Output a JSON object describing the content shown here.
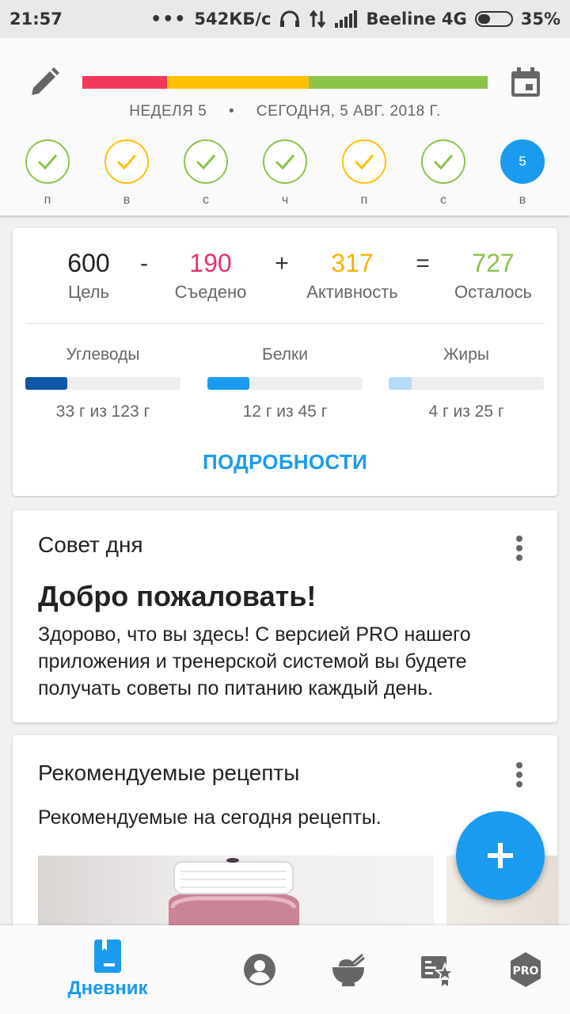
{
  "status_bar": {
    "time": "21:57",
    "dots": "•••",
    "speed": "542КБ/с",
    "carrier": "Beeline 4G",
    "battery": "35%",
    "battery_level": 0.35
  },
  "header": {
    "week": "НЕДЕЛЯ 5",
    "separator": "•",
    "date": "СЕГОДНЯ, 5 АВГ. 2018 Г.",
    "progress_colors": [
      "#f2395d",
      "#ffc107",
      "#8bc34a"
    ],
    "days": [
      {
        "label": "п",
        "state": "green"
      },
      {
        "label": "в",
        "state": "yellow"
      },
      {
        "label": "с",
        "state": "green"
      },
      {
        "label": "ч",
        "state": "green"
      },
      {
        "label": "п",
        "state": "yellow"
      },
      {
        "label": "с",
        "state": "green"
      },
      {
        "label": "в",
        "state": "today",
        "number": "5"
      }
    ]
  },
  "summary": {
    "goal": {
      "value": "600",
      "label": "Цель",
      "color": "#222222"
    },
    "eaten": {
      "value": "190",
      "label": "Съедено",
      "color": "#e8326b"
    },
    "activity": {
      "value": "317",
      "label": "Активность",
      "color": "#f5b400"
    },
    "remaining": {
      "value": "727",
      "label": "Осталось",
      "color": "#8bc34a"
    },
    "op_minus": "-",
    "op_plus": "+",
    "op_equals": "=",
    "macros": [
      {
        "name": "Углеводы",
        "value": "33 г из 123 г",
        "fraction": 0.27,
        "color": "#0d57a6"
      },
      {
        "name": "Белки",
        "value": "12 г из 45 г",
        "fraction": 0.27,
        "color": "#1a9bef"
      },
      {
        "name": "Жиры",
        "value": "4 г из 25 г",
        "fraction": 0.15,
        "color": "#b4dcf8"
      }
    ],
    "details": "ПОДРОБНОСТИ"
  },
  "tip": {
    "title": "Совет дня",
    "heading": "Добро пожаловать!",
    "body": "Здорово, что вы здесь! С версией PRO нашего приложения и тренерской системой вы будете получать советы по питанию каждый день."
  },
  "recipes": {
    "title": "Рекомендуемые рецепты",
    "subtitle": "Рекомендуемые на сегодня рецепты."
  },
  "bottom_nav": {
    "diary_label": "Дневник",
    "pro_label": "PRO",
    "active_color": "#1a9bef",
    "icons": [
      "diary-icon",
      "profile-icon",
      "recipes-bowl-icon",
      "plans-icon",
      "pro-badge-icon"
    ]
  },
  "accent": "#1a9bef"
}
